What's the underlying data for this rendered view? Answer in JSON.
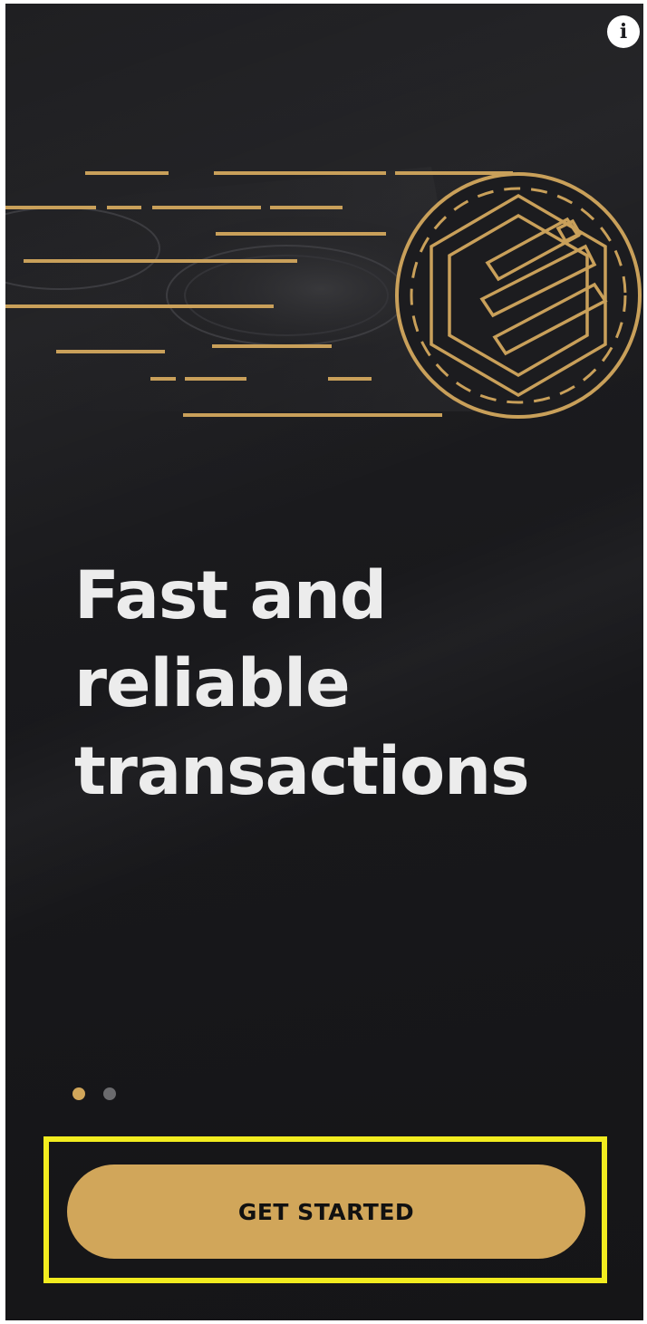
{
  "info_button": {
    "icon": "info-icon",
    "glyph": "i"
  },
  "hero": {
    "icon": "coin-logo-icon"
  },
  "headline": {
    "lines": [
      "Fast and",
      "reliable",
      "transactions"
    ]
  },
  "pager": {
    "count": 2,
    "active_index": 0
  },
  "cta": {
    "label": "GET STARTED"
  },
  "colors": {
    "background": "#1c1c1f",
    "accent": "#d1a65a",
    "headline": "#ececec",
    "dot_inactive": "#6b6b6e",
    "highlight": "#f2ec1f"
  }
}
